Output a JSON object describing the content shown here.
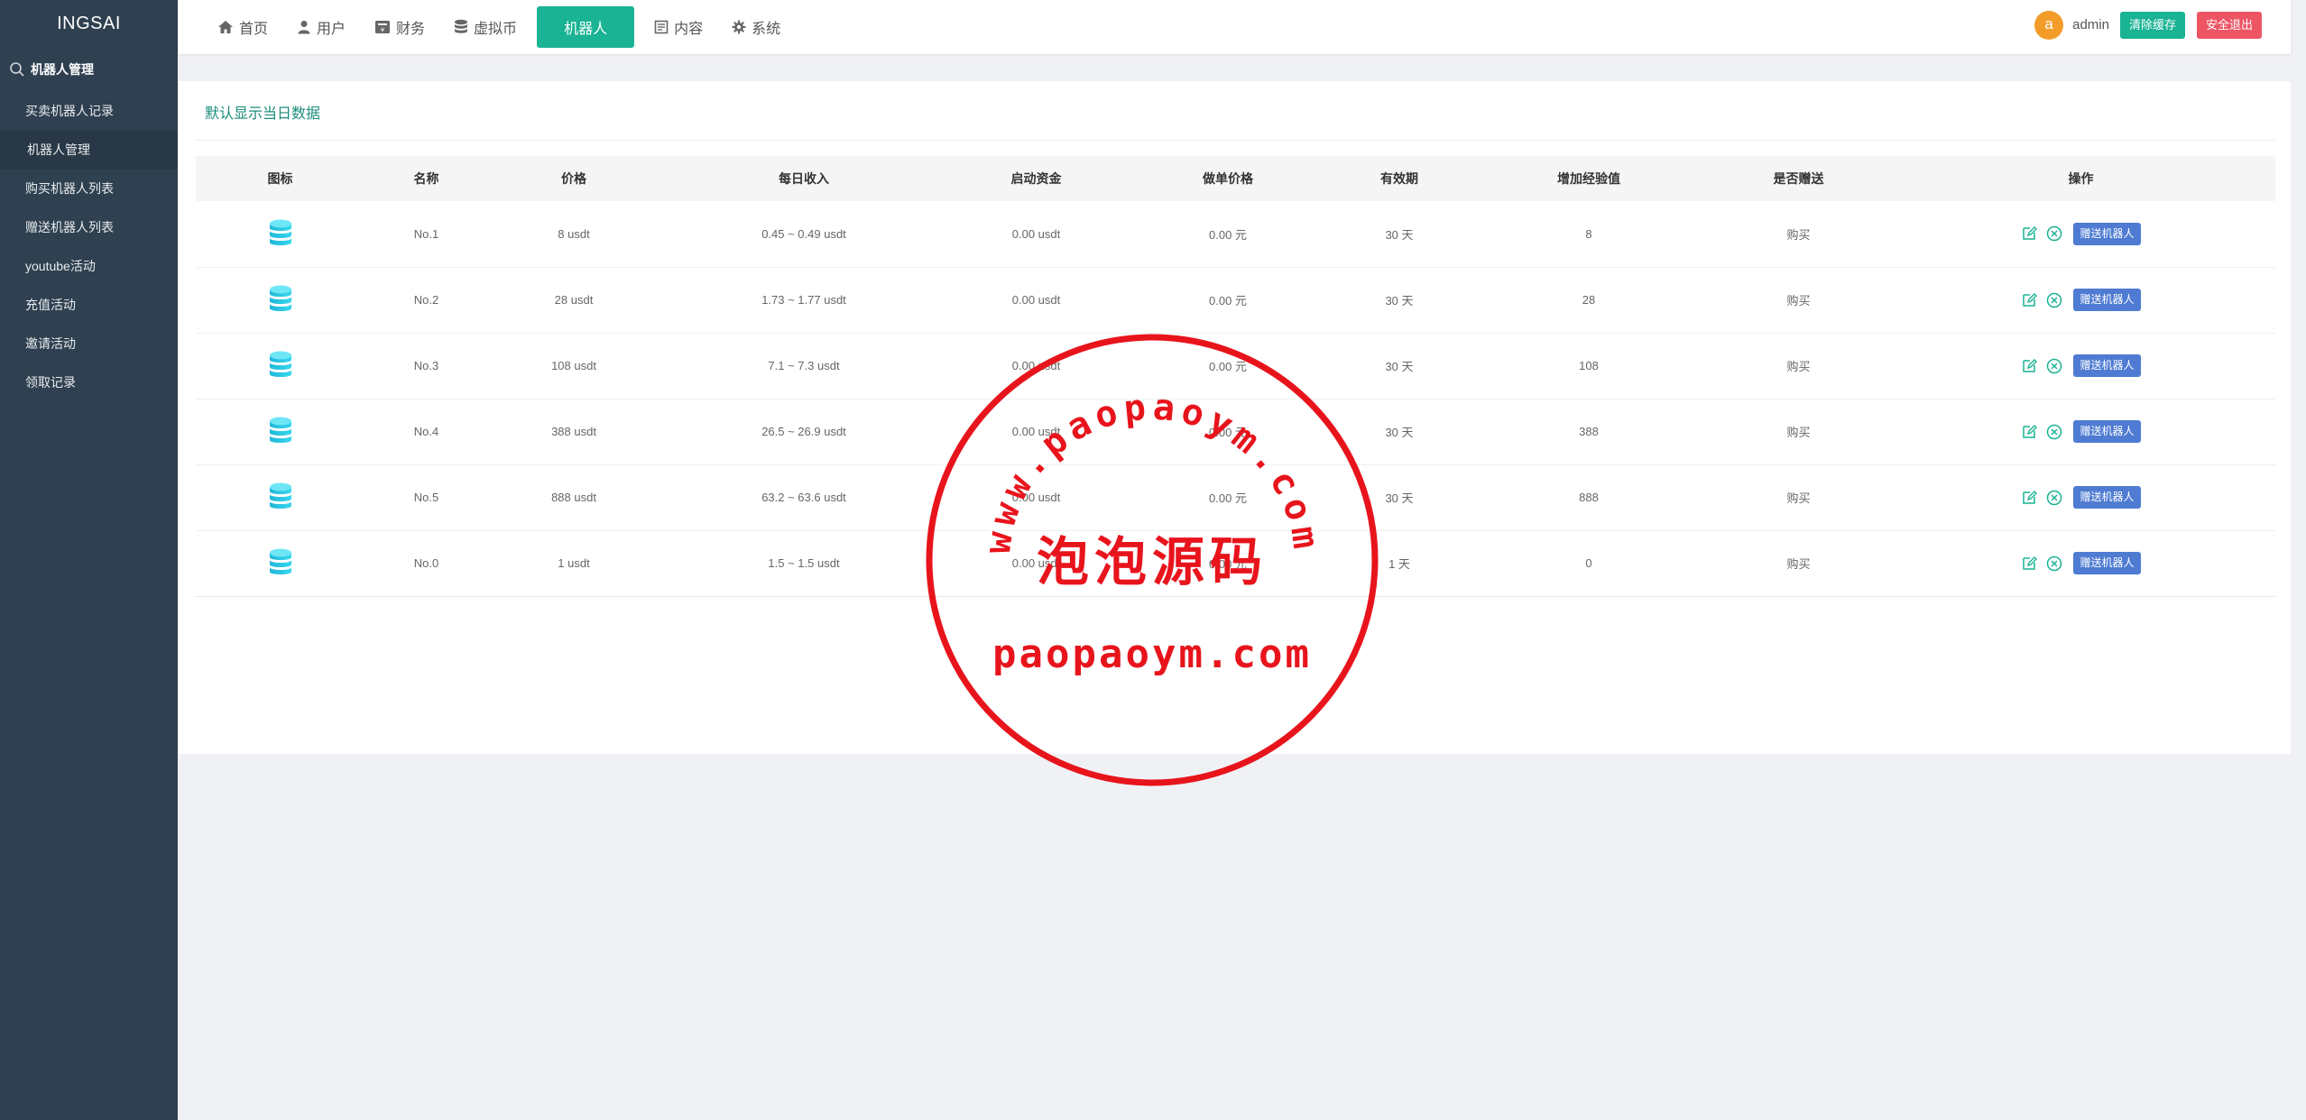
{
  "brand": "INGSAI",
  "sidebar": {
    "section": "机器人管理",
    "items": [
      {
        "label": "买卖机器人记录",
        "active": false
      },
      {
        "label": "机器人管理",
        "active": true
      },
      {
        "label": "购买机器人列表",
        "active": false
      },
      {
        "label": "赠送机器人列表",
        "active": false
      },
      {
        "label": "youtube活动",
        "active": false
      },
      {
        "label": "充值活动",
        "active": false
      },
      {
        "label": "邀请活动",
        "active": false
      },
      {
        "label": "领取记录",
        "active": false
      }
    ]
  },
  "nav": [
    {
      "label": "首页",
      "icon": "home-icon"
    },
    {
      "label": "用户",
      "icon": "user-icon"
    },
    {
      "label": "财务",
      "icon": "finance-icon"
    },
    {
      "label": "虚拟币",
      "icon": "database-icon"
    },
    {
      "label": "机器人",
      "icon": "",
      "active": true
    },
    {
      "label": "内容",
      "icon": "content-icon"
    },
    {
      "label": "系统",
      "icon": "gear-icon"
    }
  ],
  "user": {
    "avatar_letter": "a",
    "name": "admin",
    "clear_cache": "清除缓存",
    "logout": "安全退出"
  },
  "main": {
    "title": "默认显示当日数据",
    "columns": [
      "图标",
      "名称",
      "价格",
      "每日收入",
      "启动资金",
      "做单价格",
      "有效期",
      "增加经验值",
      "是否赠送",
      "操作"
    ],
    "rows": [
      {
        "name": "No.1",
        "price": "8 usdt",
        "income": "0.45 ~ 0.49 usdt",
        "start_fund": "0.00 usdt",
        "order_price": "0.00 元",
        "validity": "30 天",
        "exp": "8",
        "gift": "购买"
      },
      {
        "name": "No.2",
        "price": "28 usdt",
        "income": "1.73 ~ 1.77 usdt",
        "start_fund": "0.00 usdt",
        "order_price": "0.00 元",
        "validity": "30 天",
        "exp": "28",
        "gift": "购买"
      },
      {
        "name": "No.3",
        "price": "108 usdt",
        "income": "7.1 ~ 7.3 usdt",
        "start_fund": "0.00 usdt",
        "order_price": "0.00 元",
        "validity": "30 天",
        "exp": "108",
        "gift": "购买"
      },
      {
        "name": "No.4",
        "price": "388 usdt",
        "income": "26.5 ~ 26.9 usdt",
        "start_fund": "0.00 usdt",
        "order_price": "0.00 元",
        "validity": "30 天",
        "exp": "388",
        "gift": "购买"
      },
      {
        "name": "No.5",
        "price": "888 usdt",
        "income": "63.2 ~ 63.6 usdt",
        "start_fund": "0.00 usdt",
        "order_price": "0.00 元",
        "validity": "30 天",
        "exp": "888",
        "gift": "购买"
      },
      {
        "name": "No.0",
        "price": "1 usdt",
        "income": "1.5 ~ 1.5 usdt",
        "start_fund": "0.00 usdt",
        "order_price": "0.00 元",
        "validity": "1 天",
        "exp": "0",
        "gift": "购买"
      }
    ],
    "action_label": "赠送机器人"
  },
  "watermark": {
    "arc_text": "www.paopaoym.com",
    "center_text": "泡泡源码",
    "bottom_text": "paopaoym.com"
  },
  "colors": {
    "accent": "#1ab394",
    "sidebar": "#2f4050",
    "danger": "#ed5565",
    "primary": "#4f7cd2",
    "stamp": "#e8141c"
  }
}
